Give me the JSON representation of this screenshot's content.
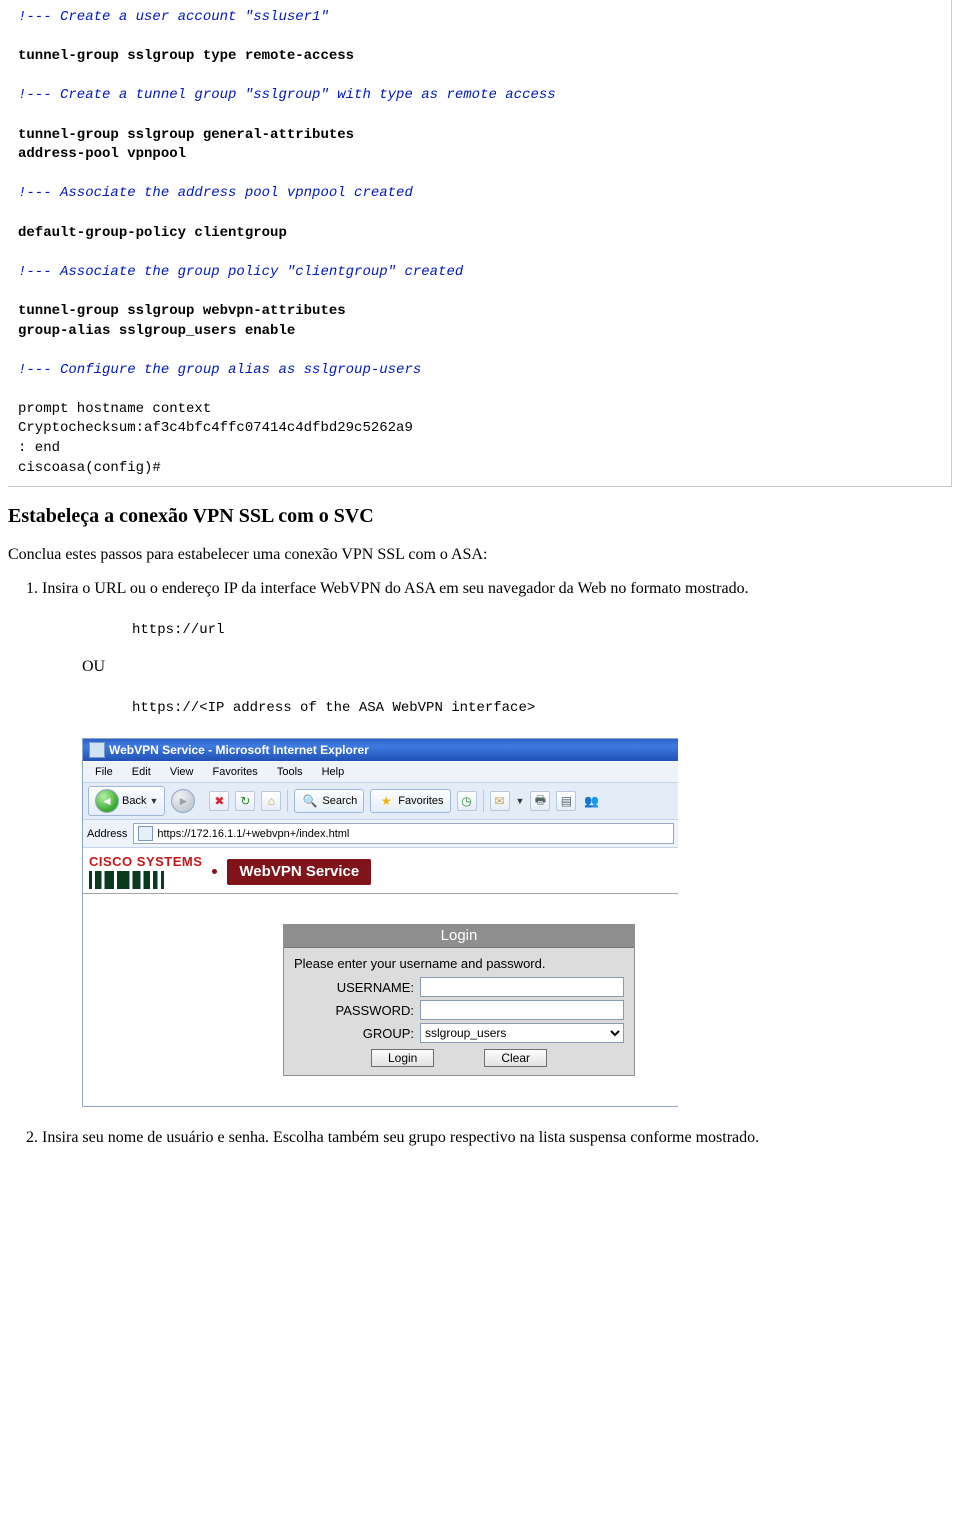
{
  "code": {
    "c1": "!--- Create a user account \"ssluser1\"",
    "l1": "tunnel-group sslgroup type remote-access",
    "c2": "!--- Create a tunnel group \"sslgroup\" with type as remote access",
    "l2a": "tunnel-group sslgroup general-attributes",
    "l2b": " address-pool vpnpool",
    "c3": "!--- Associate the address pool vpnpool created",
    "l3": " default-group-policy clientgroup",
    "c4": "!--- Associate the group policy \"clientgroup\" created",
    "l4a": "tunnel-group sslgroup webvpn-attributes",
    "l4b": " group-alias sslgroup_users enable",
    "c5": "!--- Configure the group alias as sslgroup-users",
    "l5": "prompt hostname context",
    "l6": "Cryptochecksum:af3c4bfc4ffc07414c4dfbd29c5262a9",
    "l7": ": end",
    "l8": "ciscoasa(config)#"
  },
  "heading": "Estabeleça a conexão VPN SSL com o SVC",
  "intro": "Conclua estes passos para estabelecer uma conexão VPN SSL com o ASA:",
  "step1": "Insira o URL ou o endereço IP da interface WebVPN do ASA em seu navegador da Web no formato mostrado.",
  "url1": "https://url",
  "ou": "OU",
  "url2": "https://<IP address of the ASA WebVPN interface>",
  "browser": {
    "title": "WebVPN Service - Microsoft Internet Explorer",
    "menus": [
      "File",
      "Edit",
      "View",
      "Favorites",
      "Tools",
      "Help"
    ],
    "back": "Back",
    "search": "Search",
    "favorites": "Favorites",
    "address_label": "Address",
    "address_value": "https://172.16.1.1/+webvpn+/index.html",
    "cisco": "CISCO SYSTEMS",
    "service": "WebVPN Service",
    "login_title": "Login",
    "login_prompt": "Please enter your username and password.",
    "username_lbl": "USERNAME:",
    "password_lbl": "PASSWORD:",
    "group_lbl": "GROUP:",
    "group_value": "sslgroup_users",
    "login_btn": "Login",
    "clear_btn": "Clear"
  },
  "step2": "Insira seu nome de usuário e senha. Escolha também seu grupo respectivo na lista suspensa conforme mostrado."
}
